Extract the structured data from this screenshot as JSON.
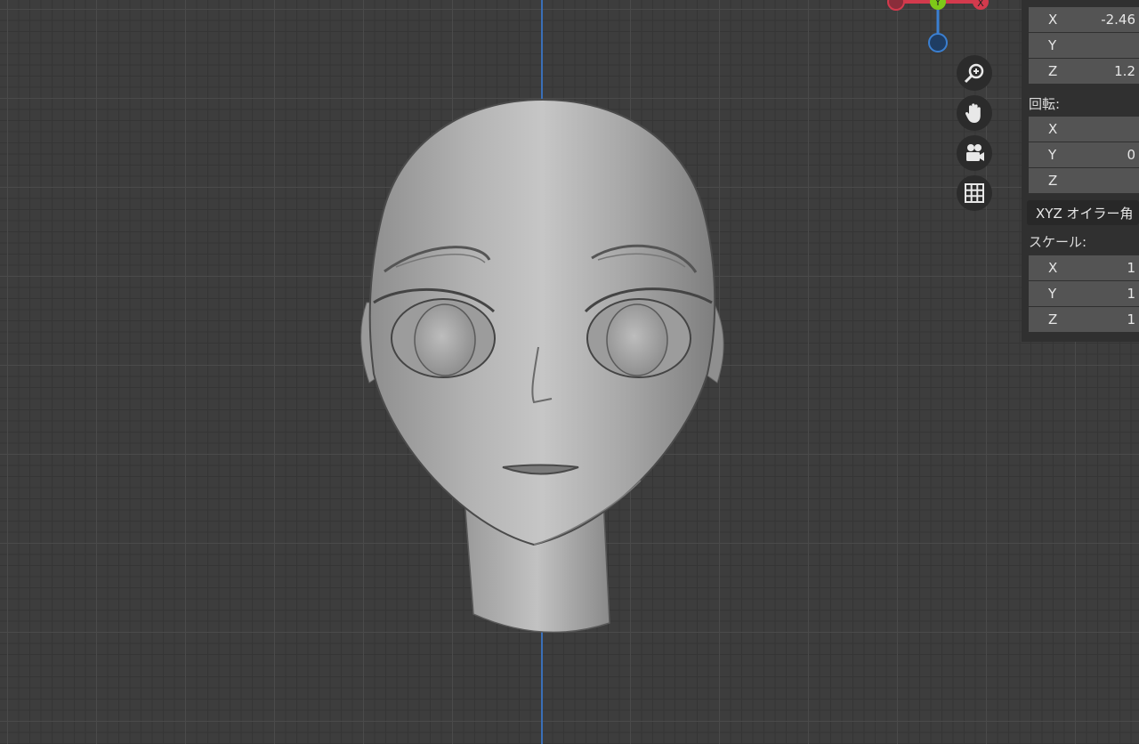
{
  "viewport": {
    "navigation_icons": [
      "zoom-icon",
      "hand-pan-icon",
      "camera-icon",
      "grid-icon"
    ],
    "gizmo": {
      "x_label": "X",
      "y_label": "Y",
      "x_color": "#d33a4d",
      "y_color": "#7ec918",
      "z_color": "#3a7fd1"
    },
    "colors": {
      "grid_bg": "#3d3d3d",
      "z_axis": "#3a6fb8",
      "panel_bg": "#303030"
    }
  },
  "npanel": {
    "location": [
      {
        "axis": "X",
        "value": "-2.46"
      },
      {
        "axis": "Y",
        "value": ""
      },
      {
        "axis": "Z",
        "value": "1.2"
      }
    ],
    "rotation_label": "回転:",
    "rotation": [
      {
        "axis": "X",
        "value": ""
      },
      {
        "axis": "Y",
        "value": "0"
      },
      {
        "axis": "Z",
        "value": ""
      }
    ],
    "rotation_mode": "XYZ オイラー角",
    "scale_label": "スケール:",
    "scale": [
      {
        "axis": "X",
        "value": "1"
      },
      {
        "axis": "Y",
        "value": "1"
      },
      {
        "axis": "Z",
        "value": "1"
      }
    ]
  }
}
